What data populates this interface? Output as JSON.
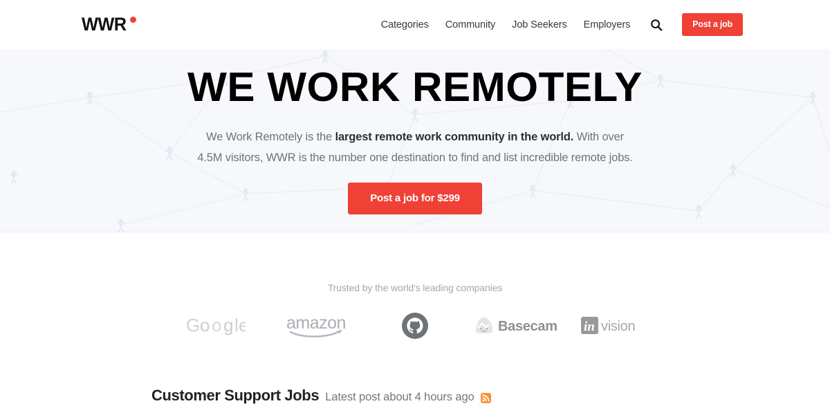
{
  "header": {
    "logo": {
      "text": "WWR",
      "dot_icon": "red-dot-icon",
      "dot_color": "#ef4136"
    },
    "nav": [
      {
        "label": "Categories",
        "name": "nav-link-categories"
      },
      {
        "label": "Community",
        "name": "nav-link-community"
      },
      {
        "label": "Job Seekers",
        "name": "nav-link-job-seekers"
      },
      {
        "label": "Employers",
        "name": "nav-link-employers"
      }
    ],
    "search_icon": "search-icon",
    "post_button": {
      "label": "Post a job",
      "color": "#ef4136"
    }
  },
  "hero": {
    "title": "WE WORK REMOTELY",
    "subtitle_part1": "We Work Remotely is the ",
    "subtitle_bold": "largest remote work community in the world.",
    "subtitle_part2": " With over 4.5M visitors, WWR is the number one destination to find and list incredible remote jobs.",
    "cta": {
      "label": "Post a job for $299",
      "color": "#ef4136"
    },
    "background": "#f7f8fb"
  },
  "trusted": {
    "label": "Trusted by the world's leading companies",
    "logos": [
      {
        "name": "google-logo",
        "alt": "Google"
      },
      {
        "name": "amazon-logo",
        "alt": "amazon"
      },
      {
        "name": "github-logo",
        "alt": "GitHub"
      },
      {
        "name": "basecamp-logo",
        "alt": "Basecamp"
      },
      {
        "name": "invision-logo",
        "alt": "InVision"
      }
    ]
  },
  "jobs_section": {
    "title": "Customer Support Jobs",
    "meta": "Latest post about 4 hours ago",
    "rss_icon": "rss-icon",
    "rss_color": "#f79433"
  }
}
